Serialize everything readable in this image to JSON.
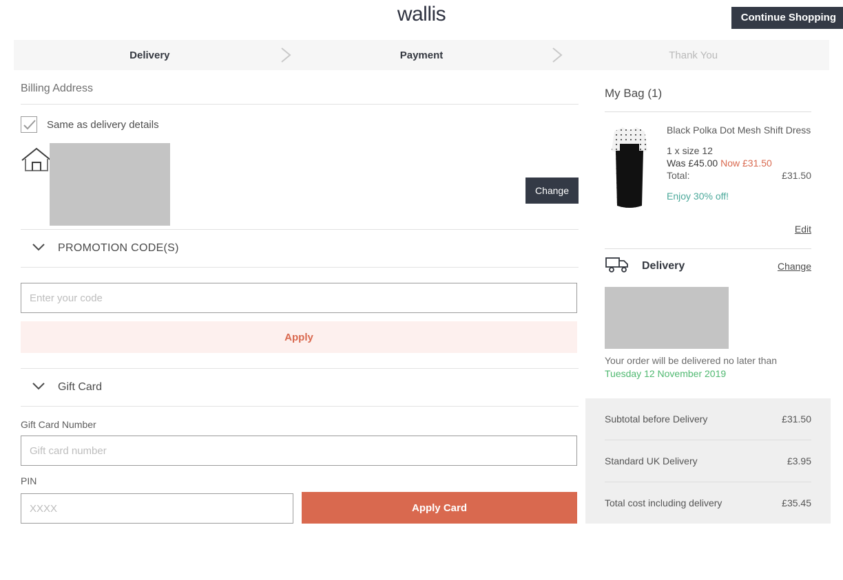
{
  "header": {
    "logo_text": "wallis",
    "continue_shopping_label": "Continue Shopping"
  },
  "stepper": {
    "steps": [
      {
        "label": "Delivery",
        "state": "active"
      },
      {
        "label": "Payment",
        "state": "active"
      },
      {
        "label": "Thank You",
        "state": "inactive"
      }
    ]
  },
  "billing": {
    "section_title": "Billing Address",
    "same_as_delivery_label": "Same as delivery details",
    "change_label": "Change"
  },
  "promotion": {
    "accordion_label": "PROMOTION CODE(S)",
    "code_placeholder": "Enter your code",
    "code_value": "",
    "apply_label": "Apply"
  },
  "giftcard": {
    "accordion_label": "Gift Card",
    "number_label": "Gift Card Number",
    "number_placeholder": "Gift card number",
    "number_value": "",
    "pin_label": "PIN",
    "pin_placeholder": "XXXX",
    "pin_value": "",
    "apply_card_label": "Apply Card"
  },
  "bag": {
    "title": "My Bag (1)",
    "item": {
      "name": "Black Polka Dot Mesh Shift Dress",
      "size_line": "1 x size 12",
      "was_label": "Was £45.00",
      "now_label": "Now £31.50",
      "total_label": "Total:",
      "total_value": "£31.50",
      "promo_note": "Enjoy 30% off!"
    },
    "edit_label": "Edit",
    "delivery": {
      "title": "Delivery",
      "change_label": "Change",
      "note": "Your order will be delivered no later than",
      "date": "Tuesday 12 November 2019"
    },
    "totals": [
      {
        "label": "Subtotal before Delivery",
        "value": "£31.50"
      },
      {
        "label": "Standard UK Delivery",
        "value": "£3.95"
      },
      {
        "label": "Total cost including delivery",
        "value": "£35.45"
      }
    ]
  },
  "colors": {
    "brand_dark": "#343a46",
    "accent_salmon": "#d9694f",
    "promo_teal": "#4aa89a",
    "date_green": "#4fb870",
    "panel_grey": "#efefef"
  }
}
